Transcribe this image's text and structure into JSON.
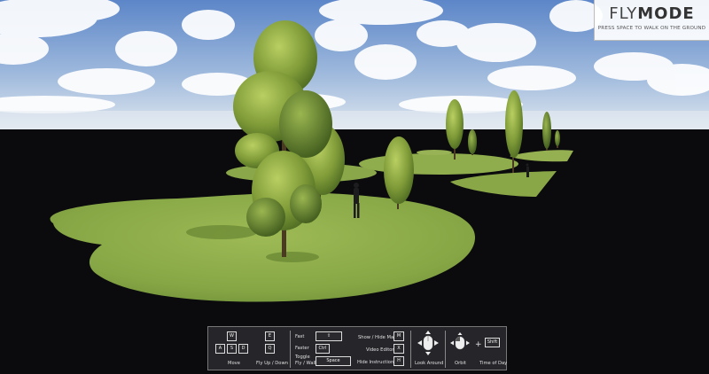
{
  "mode_panel": {
    "title_part1": "FLY",
    "title_part2": "MODE",
    "hint": "PRESS SPACE TO WALK ON THE GROUND"
  },
  "controls": {
    "move": {
      "keys": [
        "W",
        "A",
        "S",
        "D"
      ],
      "label": "Move"
    },
    "fly_up_down": {
      "keys": [
        "E",
        "Q"
      ],
      "label": "Fly Up / Down"
    },
    "speed": {
      "fast_label": "Fast",
      "fast_key": "⇧",
      "faster_label": "Faster",
      "faster_key": "Ctrl",
      "toggle_label_1": "Toggle",
      "toggle_label_2": "Fly / Walk",
      "toggle_key": "Space"
    },
    "toggles": [
      {
        "label": "Show / Hide Map",
        "key": "M"
      },
      {
        "label": "Video Editor",
        "key": "X"
      },
      {
        "label": "Hide Instructions",
        "key": "H"
      }
    ],
    "look_around_label": "Look Around",
    "orbit_label": "Orbit",
    "plus_sign": "+",
    "time_of_day_key": "Shift",
    "time_of_day_label": "Time of Day"
  },
  "colors": {
    "sky_top": "#5f88c9",
    "sky_bottom": "#d6e2ee",
    "void": "#0b0b0e",
    "grass": "#8eae4c",
    "hud_bg": "#28282c"
  }
}
